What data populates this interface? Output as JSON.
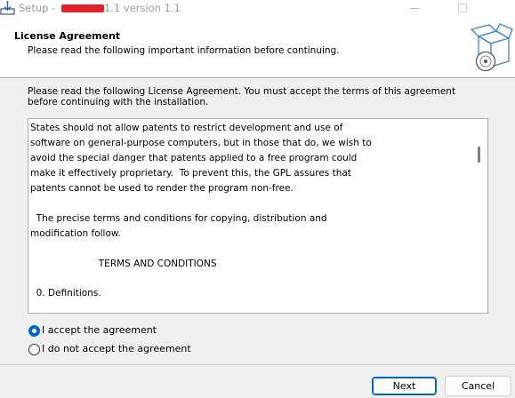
{
  "window": {
    "title_prefix": "Setup - ",
    "title_suffix": "1.1 version 1.1"
  },
  "header": {
    "title": "License Agreement",
    "subtitle": "Please read the following important information before continuing."
  },
  "intro_text": "Please read the following License Agreement. You must accept the terms of this agreement before continuing with the installation.",
  "license_lines": [
    "States should not allow patents to restrict development and use of",
    "software on general-purpose computers, but in those that do, we wish to",
    "avoid the special danger that patents applied to a free program could",
    "make it effectively proprietary.  To prevent this, the GPL assures that",
    "patents cannot be used to render the program non-free.",
    "",
    "  The precise terms and conditions for copying, distribution and",
    "modification follow.",
    "",
    "                       TERMS AND CONDITIONS",
    "",
    "  0. Definitions."
  ],
  "options": {
    "accept": {
      "label": "I accept the agreement",
      "selected": true
    },
    "decline": {
      "label": "I do not accept the agreement",
      "selected": false
    }
  },
  "buttons": {
    "next": "Next",
    "cancel": "Cancel"
  },
  "icons": {
    "app": "setup-installer-icon",
    "header": "software-box-disc-icon"
  },
  "colors": {
    "accent": "#0067c0",
    "redaction": "#e0242a"
  }
}
